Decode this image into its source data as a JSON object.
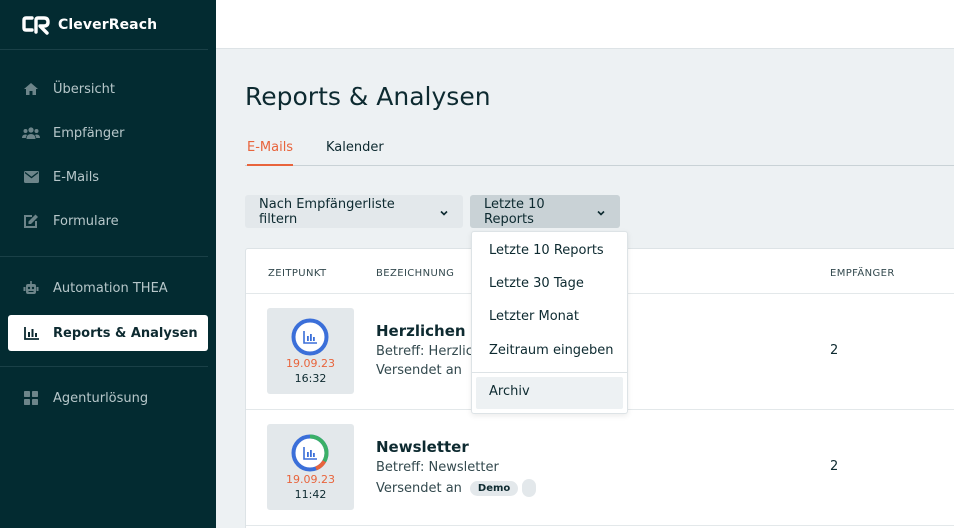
{
  "brand": {
    "name": "CleverReach"
  },
  "sidebar": {
    "items": [
      {
        "label": "Übersicht",
        "icon": "home-icon"
      },
      {
        "label": "Empfänger",
        "icon": "users-icon"
      },
      {
        "label": "E-Mails",
        "icon": "envelope-icon"
      },
      {
        "label": "Formulare",
        "icon": "edit-icon"
      },
      {
        "label": "Automation THEA",
        "icon": "robot-icon"
      },
      {
        "label": "Reports & Analysen",
        "icon": "chart-icon",
        "active": true
      },
      {
        "label": "Agenturlösung",
        "icon": "grid-icon"
      }
    ]
  },
  "page": {
    "title": "Reports & Analysen"
  },
  "tabs": [
    {
      "label": "E-Mails",
      "active": true
    },
    {
      "label": "Kalender"
    }
  ],
  "filters": {
    "list_filter": "Nach Empfängerliste filtern",
    "period_filter": "Letzte 10 Reports"
  },
  "dropdown": {
    "options": [
      "Letzte 10 Reports",
      "Letzte 30 Tage",
      "Letzter Monat",
      "Zeitraum eingeben",
      "Archiv"
    ]
  },
  "table": {
    "columns": {
      "time": "ZEITPUNKT",
      "name": "BEZEICHNUNG",
      "recipients": "EMPFÄNGER"
    },
    "rows": [
      {
        "date": "19.09.23",
        "time": "16:32",
        "title": "Herzlichen Gl",
        "subject": "Betreff: Herzlich",
        "sent_prefix": "Versendet an",
        "recipients": "2"
      },
      {
        "date": "19.09.23",
        "time": "11:42",
        "title": "Newsletter",
        "subject": "Betreff: Newsletter",
        "sent_prefix": "Versendet an",
        "tag": "Demo",
        "recipients": "2"
      }
    ]
  },
  "colors": {
    "sidebar": "#032b31",
    "accent": "#e8643c",
    "ring_blue": "#3b6fd9",
    "ring_green": "#3bb067"
  }
}
